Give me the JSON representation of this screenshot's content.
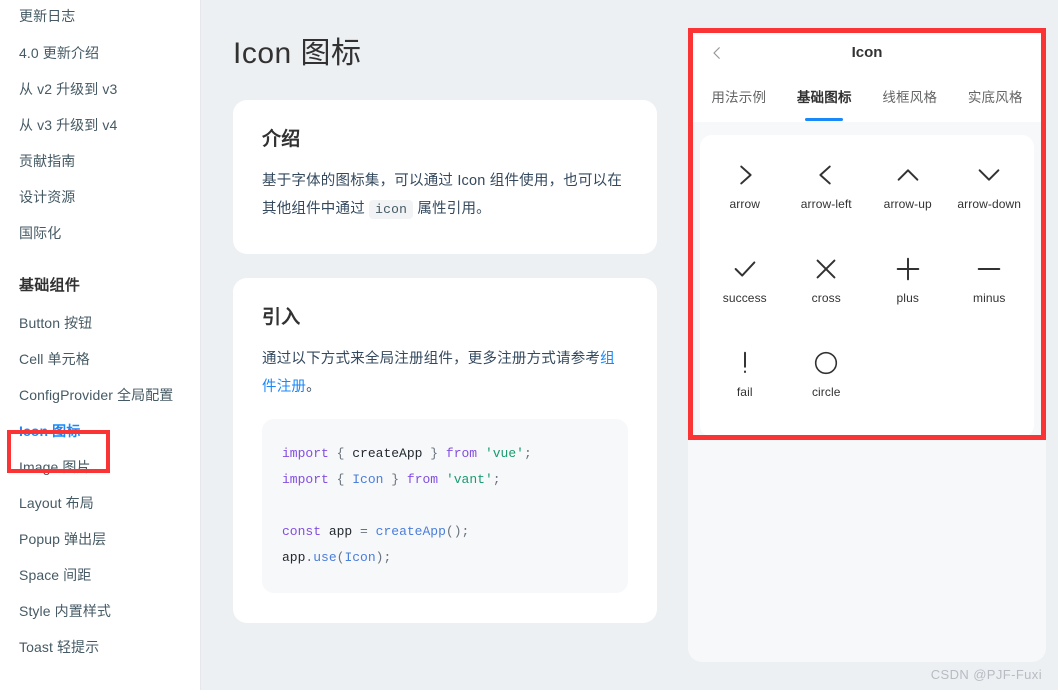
{
  "sidebar": {
    "top_links": [
      {
        "label": "更新日志"
      },
      {
        "label": "4.0 更新介绍"
      },
      {
        "label": "从 v2 升级到 v3"
      },
      {
        "label": "从 v3 升级到 v4"
      },
      {
        "label": "贡献指南"
      },
      {
        "label": "设计资源"
      },
      {
        "label": "国际化"
      }
    ],
    "group_title": "基础组件",
    "component_links": [
      {
        "label": "Button 按钮",
        "active": false
      },
      {
        "label": "Cell 单元格",
        "active": false
      },
      {
        "label": "ConfigProvider 全局配置",
        "active": false
      },
      {
        "label": "Icon 图标",
        "active": true
      },
      {
        "label": "Image 图片",
        "active": false
      },
      {
        "label": "Layout 布局",
        "active": false
      },
      {
        "label": "Popup 弹出层",
        "active": false
      },
      {
        "label": "Space 间距",
        "active": false
      },
      {
        "label": "Style 内置样式",
        "active": false
      },
      {
        "label": "Toast 轻提示",
        "active": false
      }
    ],
    "highlight_color": "#fa3434",
    "active_color": "#1989fa"
  },
  "doc": {
    "page_title": "Icon 图标",
    "intro": {
      "title": "介绍",
      "text_before_code": "基于字体的图标集，可以通过 Icon 组件使用，也可以在其他组件中通过 ",
      "inline_code": "icon",
      "text_after_code": " 属性引用。"
    },
    "install": {
      "title": "引入",
      "text_before_link": "通过以下方式来全局注册组件，更多注册方式请参考",
      "link_text": "组件注册",
      "text_after_link": "。",
      "code_lines": [
        "import { createApp } from 'vue';",
        "import { Icon } from 'vant';",
        "",
        "const app = createApp();",
        "app.use(Icon);"
      ]
    }
  },
  "preview": {
    "back_icon": "chevron-left-icon",
    "title": "Icon",
    "tabs": [
      {
        "label": "用法示例",
        "active": false
      },
      {
        "label": "基础图标",
        "active": true
      },
      {
        "label": "线框风格",
        "active": false
      },
      {
        "label": "实底风格",
        "active": false
      }
    ],
    "accent_color": "#1989fa",
    "icons": [
      {
        "name": "arrow",
        "glyph": "chevron-right-icon"
      },
      {
        "name": "arrow-left",
        "glyph": "chevron-left-icon"
      },
      {
        "name": "arrow-up",
        "glyph": "chevron-up-icon"
      },
      {
        "name": "arrow-down",
        "glyph": "chevron-down-icon"
      },
      {
        "name": "success",
        "glyph": "check-icon"
      },
      {
        "name": "cross",
        "glyph": "cross-icon"
      },
      {
        "name": "plus",
        "glyph": "plus-icon"
      },
      {
        "name": "minus",
        "glyph": "minus-icon"
      },
      {
        "name": "fail",
        "glyph": "exclamation-icon"
      },
      {
        "name": "circle",
        "glyph": "circle-icon"
      }
    ]
  },
  "watermark": "CSDN @PJF-Fuxi"
}
